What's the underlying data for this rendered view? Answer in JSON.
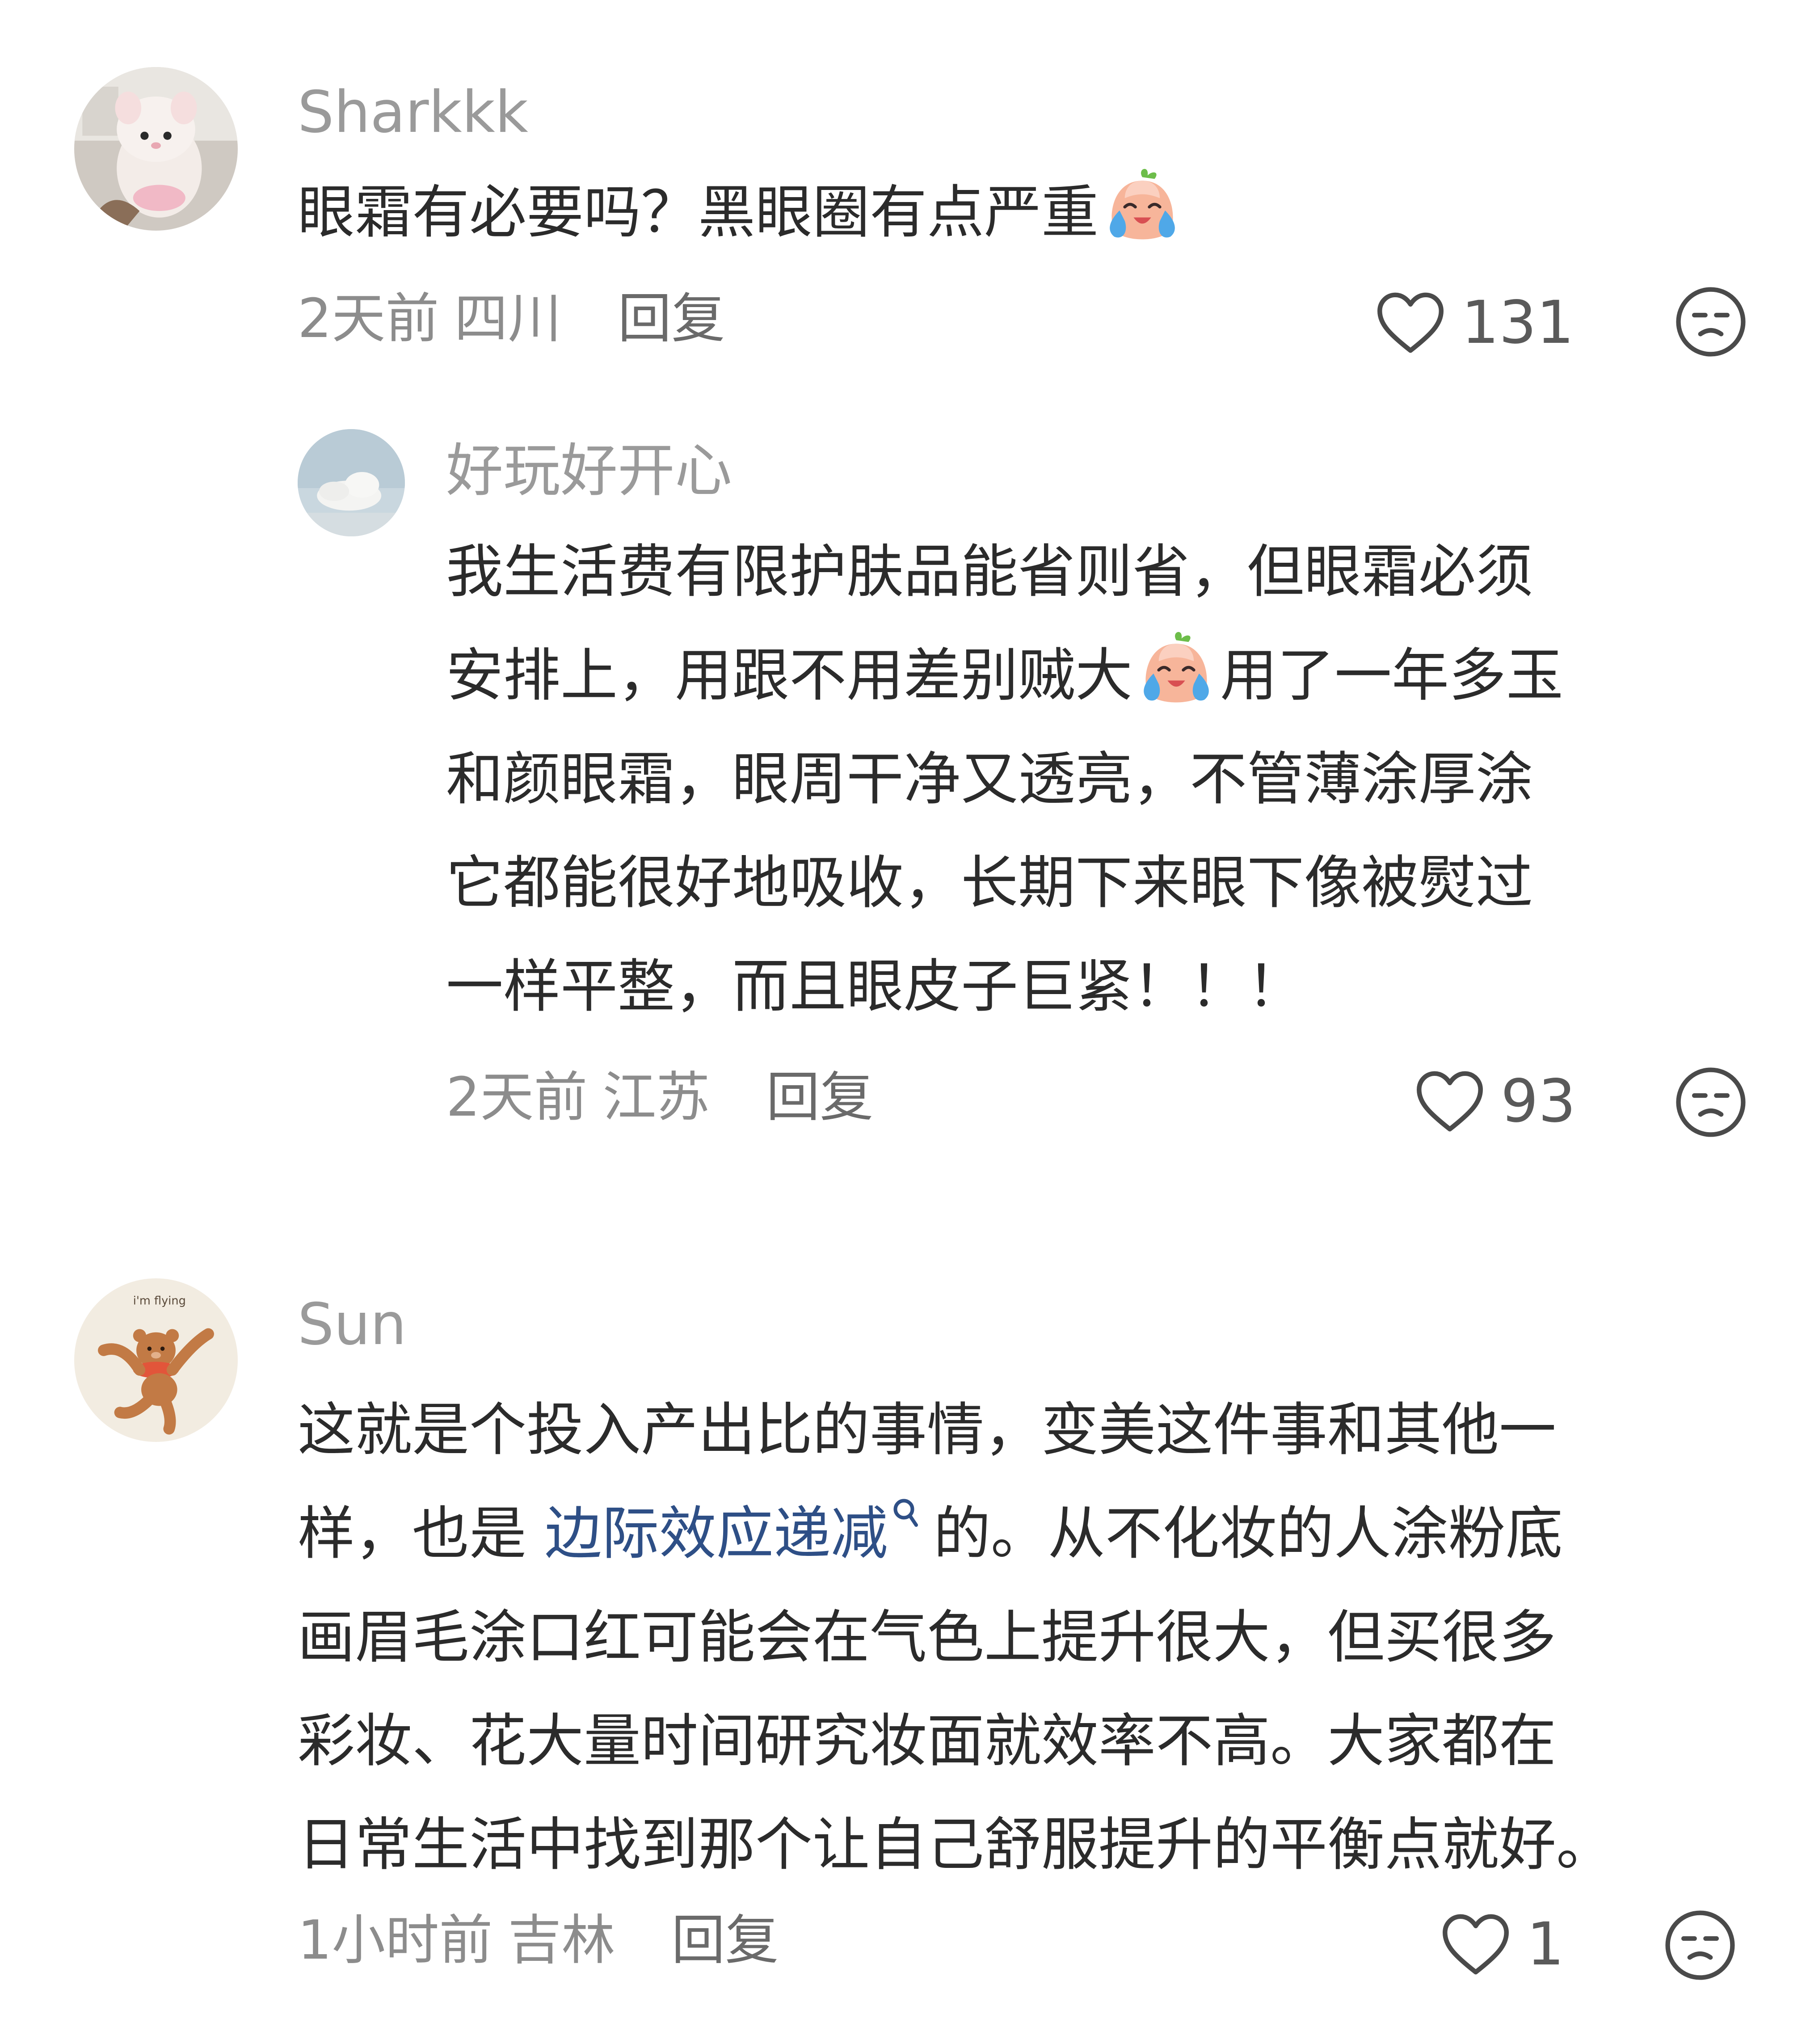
{
  "comments": [
    {
      "user": "Sharkkk",
      "text_lines": [
        "眼霜有必要吗？黑眼圈有点严重"
      ],
      "time": "2天前",
      "location": "四川",
      "reply_label": "回复",
      "likes": "131",
      "replies": [
        {
          "user": "好玩好开心",
          "line1": "我生活费有限护肤品能省则省，但眼霜必须",
          "line2_a": "安排上，用跟不用差别贼大",
          "line2_b": "用了一年多玉",
          "line3": "和颜眼霜，眼周干净又透亮，不管薄涂厚涂",
          "line4": "它都能很好地吸收，长期下来眼下像被熨过",
          "line5": "一样平整，而且眼皮子巨紧！！！",
          "time": "2天前",
          "location": "江苏",
          "reply_label": "回复",
          "likes": "93"
        }
      ]
    },
    {
      "user": "Sun",
      "line1": "这就是个投入产出比的事情，变美这件事和其他一",
      "line2_a": "样，也是",
      "line2_link": "边际效应递减",
      "line2_b": "的。从不化妆的人涂粉底",
      "line3": "画眉毛涂口红可能会在气色上提升很大，但买很多",
      "line4": "彩妆、花大量时间研究妆面就效率不高。大家都在",
      "line5": "日常生活中找到那个让自己舒服提升的平衡点就好。",
      "time": "1小时前",
      "location": "吉林",
      "reply_label": "回复",
      "likes": "1"
    }
  ],
  "icons": {
    "like": "heart-outline-icon",
    "dislike": "neutral-face-icon",
    "emoji": "crying-peach-emoji",
    "search": "search-icon"
  },
  "colors": {
    "username": "#9a9a9a",
    "text": "#2b2b2b",
    "link": "#2e4f86",
    "meta": "#8c8c8c"
  }
}
